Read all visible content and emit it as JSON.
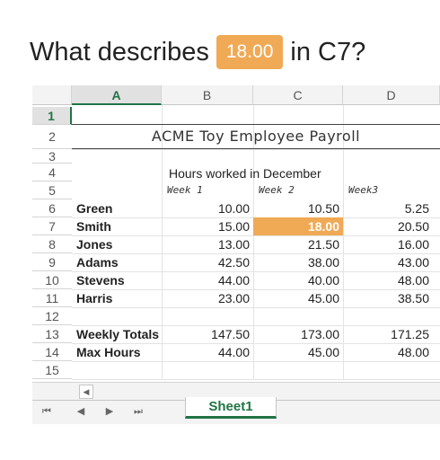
{
  "question": {
    "prefix": "What describes",
    "value": "18.00",
    "suffix": "in C7?"
  },
  "columns": [
    "A",
    "B",
    "C",
    "D"
  ],
  "rows": [
    "1",
    "2",
    "3",
    "4",
    "5",
    "6",
    "7",
    "8",
    "9",
    "10",
    "11",
    "12",
    "13",
    "14",
    "15"
  ],
  "sheet": {
    "title": "ACME Toy Employee Payroll",
    "subtitle": "Hours worked in December",
    "week_headers": [
      "Week 1",
      "Week 2",
      "Week3"
    ],
    "data": [
      {
        "name": "Green",
        "w1": "10.00",
        "w2": "10.50",
        "w3": "5.25"
      },
      {
        "name": "Smith",
        "w1": "15.00",
        "w2": "18.00",
        "w3": "20.50"
      },
      {
        "name": "Jones",
        "w1": "13.00",
        "w2": "21.50",
        "w3": "16.00"
      },
      {
        "name": "Adams",
        "w1": "42.50",
        "w2": "38.00",
        "w3": "43.00"
      },
      {
        "name": "Stevens",
        "w1": "44.00",
        "w2": "40.00",
        "w3": "48.00"
      },
      {
        "name": "Harris",
        "w1": "23.00",
        "w2": "45.00",
        "w3": "38.50"
      }
    ],
    "totals": {
      "label": "Weekly Totals",
      "w1": "147.50",
      "w2": "173.00",
      "w3": "171.25"
    },
    "max": {
      "label": "Max Hours",
      "w1": "44.00",
      "w2": "45.00",
      "w3": "48.00"
    }
  },
  "tabs": {
    "sheet_name": "Sheet1"
  },
  "nav": {
    "first": "⏮",
    "prev": "◀",
    "next": "▶",
    "last": "⏭",
    "scroll_left": "◀"
  },
  "colors": {
    "highlight": "#f0a955",
    "excel_green": "#217346"
  }
}
